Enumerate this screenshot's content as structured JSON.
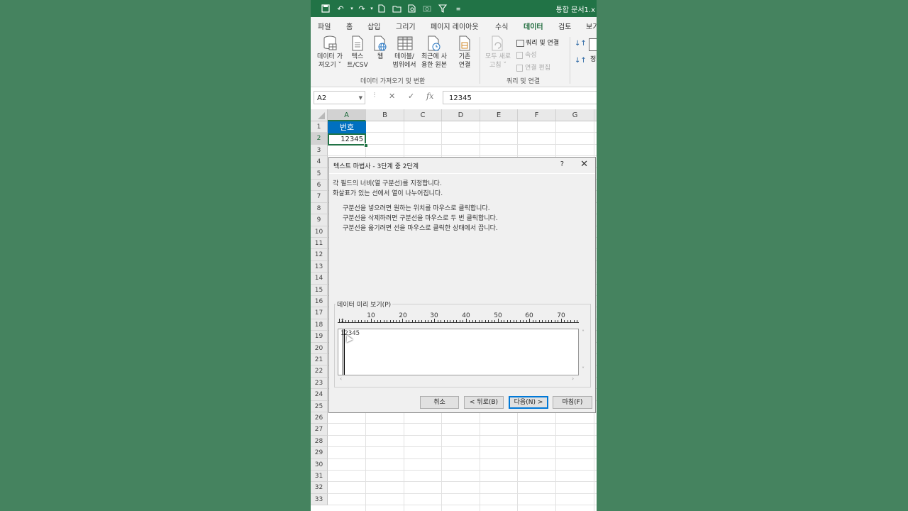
{
  "app": {
    "title": "통합 문서1.x",
    "menus": [
      "파일",
      "홈",
      "삽입",
      "그리기",
      "페이지 레이아웃",
      "수식",
      "데이터",
      "검토",
      "보기"
    ],
    "active_menu": "데이터"
  },
  "ribbon": {
    "buttons": [
      {
        "label1": "데이터 가",
        "label2": "져오기 ˅",
        "icon": "database-icon"
      },
      {
        "label1": "텍스",
        "label2": "트/CSV",
        "icon": "text-file-icon"
      },
      {
        "label1": "웹",
        "label2": "",
        "icon": "web-icon"
      },
      {
        "label1": "테이블/",
        "label2": "범위에서",
        "icon": "table-icon"
      },
      {
        "label1": "최근에 사",
        "label2": "용한 원본",
        "icon": "recent-source-icon"
      },
      {
        "label1": "기존",
        "label2": "연결",
        "icon": "existing-connection-icon"
      },
      {
        "label1": "모두 새로",
        "label2": "고침 ˅",
        "icon": "refresh-all-icon"
      }
    ],
    "group1": "데이터 가져오기 및 변환",
    "group2": "쿼리 및 연결",
    "small_items": [
      "쿼리 및 연결",
      "속성",
      "연결 편집"
    ],
    "sort_label": "정"
  },
  "formula_bar": {
    "name_box": "A2",
    "cancel": "✕",
    "enter": "✓",
    "fx": "fx",
    "value": "12345"
  },
  "sheet": {
    "columns": [
      "A",
      "B",
      "C",
      "D",
      "E",
      "F",
      "G"
    ],
    "rows": [
      "1",
      "2",
      "3",
      "4",
      "5",
      "6",
      "7",
      "8",
      "9",
      "10",
      "11",
      "12",
      "13",
      "14",
      "15",
      "16",
      "17",
      "18",
      "19",
      "20",
      "21",
      "22",
      "23",
      "24",
      "25",
      "26",
      "27",
      "28",
      "29",
      "30",
      "31",
      "32",
      "33"
    ],
    "a1": "번호",
    "a2": "12345"
  },
  "dialog": {
    "title": "텍스트 마법사 - 3단계 중 2단계",
    "help": "?",
    "close": "✕",
    "line1": "각 필드의 너비(열 구분선)를 지정합니다.",
    "line2": "화살표가 있는 선에서 열이 나누어집니다.",
    "tip1": "구분선을 넣으려면 원하는 위치를 마우스로 클릭합니다.",
    "tip2": "구분선을 삭제하려면 구분선을 마우스로 두 번 클릭합니다.",
    "tip3": "구분선을 옮기려면 선을 마우스로 클릭한 상태에서 끕니다.",
    "preview_label": "데이터 미리 보기(P)",
    "ruler": [
      "10",
      "20",
      "30",
      "40",
      "50",
      "60",
      "70"
    ],
    "preview_text": "12345",
    "buttons": {
      "cancel": "취소",
      "back": "< 뒤로(B)",
      "next": "다음(N) >",
      "finish": "마침(F)"
    }
  }
}
